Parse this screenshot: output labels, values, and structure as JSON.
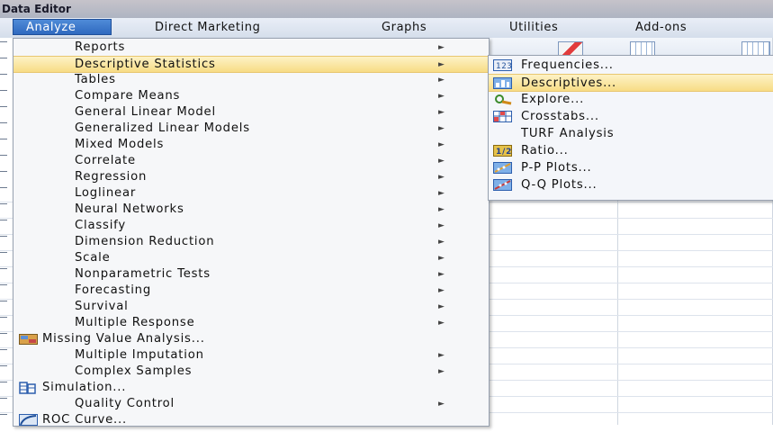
{
  "window": {
    "title": "Data Editor"
  },
  "menubar": {
    "items": [
      {
        "label": "Analyze"
      },
      {
        "label": "Direct Marketing"
      },
      {
        "label": "Graphs"
      },
      {
        "label": "Utilities"
      },
      {
        "label": "Add-ons"
      }
    ]
  },
  "analyze_menu": {
    "items": [
      {
        "label": "Reports",
        "has_submenu": true
      },
      {
        "label": "Descriptive Statistics",
        "has_submenu": true,
        "highlighted": true
      },
      {
        "label": "Tables",
        "has_submenu": true
      },
      {
        "label": "Compare Means",
        "has_submenu": true
      },
      {
        "label": "General Linear Model",
        "has_submenu": true
      },
      {
        "label": "Generalized Linear Models",
        "has_submenu": true
      },
      {
        "label": "Mixed Models",
        "has_submenu": true
      },
      {
        "label": "Correlate",
        "has_submenu": true
      },
      {
        "label": "Regression",
        "has_submenu": true
      },
      {
        "label": "Loglinear",
        "has_submenu": true
      },
      {
        "label": "Neural Networks",
        "has_submenu": true
      },
      {
        "label": "Classify",
        "has_submenu": true
      },
      {
        "label": "Dimension Reduction",
        "has_submenu": true
      },
      {
        "label": "Scale",
        "has_submenu": true
      },
      {
        "label": "Nonparametric Tests",
        "has_submenu": true
      },
      {
        "label": "Forecasting",
        "has_submenu": true
      },
      {
        "label": "Survival",
        "has_submenu": true
      },
      {
        "label": "Multiple Response",
        "has_submenu": true
      },
      {
        "label": "Missing Value Analysis...",
        "icon": "missing-value-icon"
      },
      {
        "label": "Multiple Imputation",
        "has_submenu": true
      },
      {
        "label": "Complex Samples",
        "has_submenu": true
      },
      {
        "label": "Simulation...",
        "icon": "simulation-icon"
      },
      {
        "label": "Quality Control",
        "has_submenu": true
      },
      {
        "label": "ROC Curve...",
        "icon": "roc-curve-icon"
      }
    ]
  },
  "descriptive_submenu": {
    "items": [
      {
        "label": "Frequencies...",
        "icon": "frequencies-icon"
      },
      {
        "label": "Descriptives...",
        "icon": "descriptives-icon",
        "highlighted": true
      },
      {
        "label": "Explore...",
        "icon": "explore-icon"
      },
      {
        "label": "Crosstabs...",
        "icon": "crosstabs-icon"
      },
      {
        "label": "TURF Analysis"
      },
      {
        "label": "Ratio...",
        "icon": "ratio-icon"
      },
      {
        "label": "P-P Plots...",
        "icon": "pp-plots-icon"
      },
      {
        "label": "Q-Q Plots...",
        "icon": "qq-plots-icon"
      }
    ]
  },
  "colors": {
    "highlight": "#f7dc85",
    "menubar_active": "#2f69bf",
    "menu_bg": "#f6f7f9"
  }
}
